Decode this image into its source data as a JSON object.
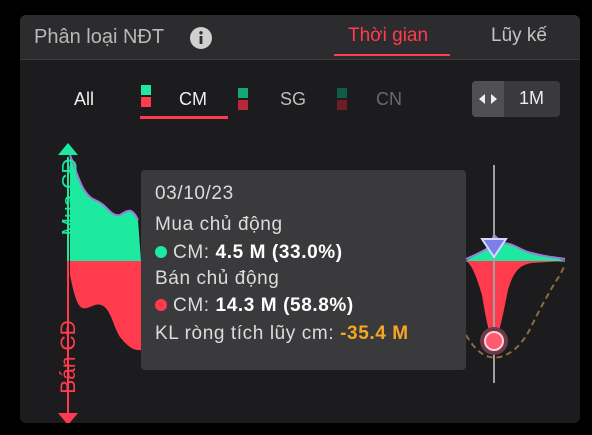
{
  "header": {
    "title": "Phân loại NĐT",
    "tabs": [
      {
        "label": "Thời gian",
        "active": true
      },
      {
        "label": "Lũy kế",
        "active": false
      }
    ]
  },
  "filters": {
    "all": "All",
    "items": [
      {
        "label": "CM",
        "active": true,
        "top_color": "#1de9a0",
        "bottom_color": "#ff3b4d"
      },
      {
        "label": "SG",
        "active": false,
        "top_color": "#13a874",
        "bottom_color": "#b8283a"
      },
      {
        "label": "CN",
        "active": false,
        "top_color": "#0d5e44",
        "bottom_color": "#6e1c26"
      }
    ]
  },
  "range": {
    "label": "1M",
    "icon": "left-right-arrows-icon"
  },
  "axis": {
    "buy_label": "Mua CĐ",
    "sell_label": "Bán CĐ"
  },
  "tooltip": {
    "date": "03/10/23",
    "buy_title": "Mua chủ động",
    "buy_series": "CM:",
    "buy_value": "4.5 M (33.0%)",
    "sell_title": "Bán chủ động",
    "sell_series": "CM:",
    "sell_value": "14.3 M (58.8%)",
    "net_label": "KL ròng tích lũy cm:",
    "net_value": "-35.4 M"
  },
  "colors": {
    "buy": "#1de9a0",
    "sell": "#ff3b4d",
    "accent": "#ff3b4d",
    "net": "#f5a623"
  }
}
